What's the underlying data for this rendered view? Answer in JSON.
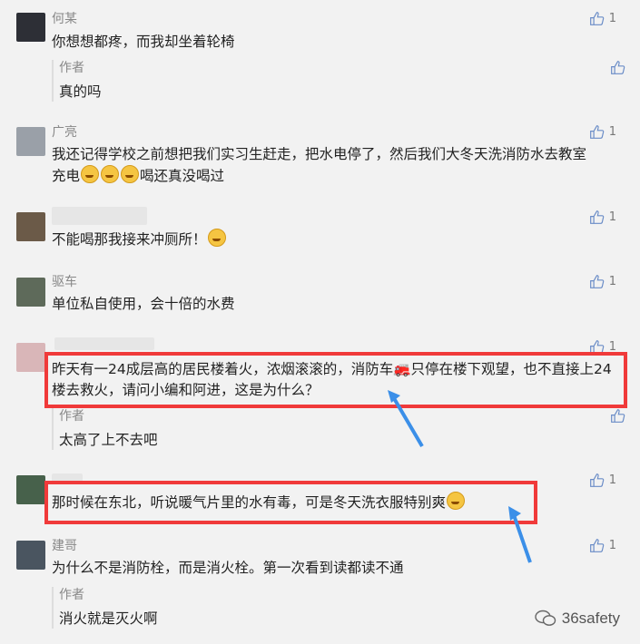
{
  "comments": [
    {
      "name": "何某",
      "text": "你想想都疼，而我却坐着轮椅",
      "likes": "1",
      "reply": {
        "name": "作者",
        "text": "真的吗"
      }
    },
    {
      "name": "广亮",
      "text": "我还记得学校之前想把我们实习生赶走，把水电停了，然后我们大冬天洗消防水去教室充电",
      "text_after": "喝还真没喝过",
      "likes": "1"
    },
    {
      "name": "",
      "text": "不能喝那我接来冲厕所！",
      "likes": "1"
    },
    {
      "name": "驱车",
      "text": "单位私自使用，会十倍的水费",
      "likes": "1"
    },
    {
      "name": "",
      "text": "昨天有一24成层高的居民楼着火，浓烟滚滚的，消防车🚒只停在楼下观望，也不直接上24楼去救火，请问小编和阿进，这是为什么？",
      "likes": "1",
      "reply": {
        "name": "作者",
        "text": "太高了上不去吧"
      }
    },
    {
      "name": "",
      "text": "那时候在东北，听说暖气片里的水有毒，可是冬天洗衣服特别爽",
      "likes": "1"
    },
    {
      "name": "建哥",
      "text": "为什么不是消防栓，而是消火栓。第一次看到读都读不通",
      "likes": "1",
      "reply": {
        "name": "作者",
        "text": "消火就是灭火啊"
      }
    }
  ],
  "watermark": "36safety",
  "colors": {
    "highlight": "#f03a3a",
    "arrow": "#3b8fe8"
  }
}
